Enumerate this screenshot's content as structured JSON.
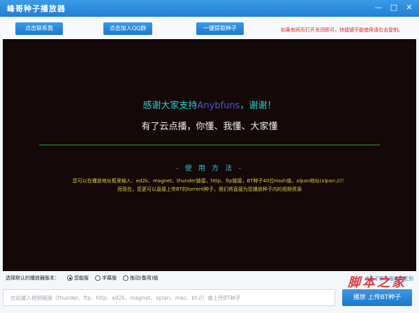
{
  "window": {
    "title": "峰哥种子播放器",
    "controls": {
      "minimize": "—",
      "maximize": "□",
      "close": "✕"
    }
  },
  "toolbar": {
    "contact_label": "点击联系我",
    "join_qq_label": "点击加入QQ群",
    "extract_label": "一键提取种子",
    "notice": "如果有网页打开关闭即可，快捷键不能使用请右击复制。"
  },
  "player": {
    "thanks_prefix": "感谢大家支持",
    "thanks_brand": "Anybfuns",
    "thanks_suffix": "，谢谢！",
    "slogan": "有了云点播，你懂、我懂、大家懂",
    "method_title": "- 使 用 方 法 -",
    "instruction_line1": "您可以在播放地址框里输入：ed2k、magnet、thunder链接，http、ftp链接，BT种子40位Hash值，xlpan地址(xlpan://)！",
    "instruction_line2": "而现在，您更可以直接上传BT的torrent种子，我们将直接为您播放种子内的视频资源"
  },
  "options": {
    "label": "选择默认的播放器版本：",
    "items": [
      {
        "label": "您能版",
        "selected": true
      },
      {
        "label": "字幕版",
        "selected": false
      },
      {
        "label": "拖动(备用)版",
        "selected": false
      }
    ],
    "diff_link": "点击了解各版本的区别"
  },
  "input": {
    "placeholder": "在此输入视频链接（thunder、ftp、http、ed2k、magnet、xplan、mac、bt://）或上传BT种子",
    "play_label": "播放 上传BT种子"
  },
  "watermark": {
    "line1": "脚本之家",
    "line2": "www.jb51.net"
  },
  "colors": {
    "titlebar": "#1f80d6",
    "button": "#1a78cf",
    "player_bg": "#140808",
    "notice": "#e8241c",
    "thanks": "#2bd2cc",
    "brand": "#4a5cd6",
    "instructions": "#d6d23c",
    "divider": "#27a136"
  }
}
